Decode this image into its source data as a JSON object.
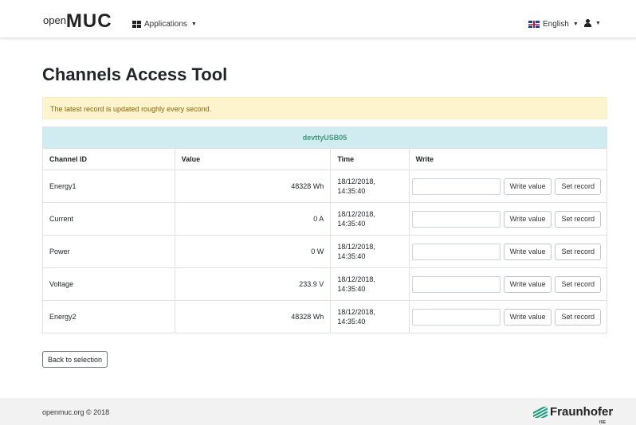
{
  "navbar": {
    "brand_open": "open",
    "brand_muc": "MUC",
    "applications_label": "Applications",
    "language_label": "English"
  },
  "page": {
    "title": "Channels Access Tool"
  },
  "alert": {
    "text": "The latest record is updated roughly every second."
  },
  "table": {
    "device": "devttyUSB05",
    "headers": {
      "channel_id": "Channel ID",
      "value": "Value",
      "time": "Time",
      "write": "Write"
    },
    "rows": [
      {
        "id": "Energy1",
        "value": "48328 Wh",
        "date": "18/12/2018,",
        "time": "14:35:40"
      },
      {
        "id": "Current",
        "value": "0 A",
        "date": "18/12/2018,",
        "time": "14:35:40"
      },
      {
        "id": "Power",
        "value": "0 W",
        "date": "18/12/2018,",
        "time": "14:35:40"
      },
      {
        "id": "Voltage",
        "value": "233.9 V",
        "date": "18/12/2018,",
        "time": "14:35:40"
      },
      {
        "id": "Energy2",
        "value": "48328 Wh",
        "date": "18/12/2018,",
        "time": "14:35:40"
      }
    ],
    "write_value_label": "Write value",
    "set_record_label": "Set record",
    "write_input_value": ""
  },
  "back_button_label": "Back to selection",
  "footer": {
    "copyright": "openmuc.org © 2018",
    "logo_text": "Fraunhofer",
    "logo_sub": "ISE"
  },
  "icons": {
    "apps": "grid-icon",
    "flag": "uk-flag-icon",
    "user": "user-icon",
    "caret": "chevron-down-icon"
  },
  "colors": {
    "alert_bg": "#fdf3cd",
    "alert_text": "#856404",
    "device_row_bg": "#d1ecf1",
    "device_text": "#3d9a77",
    "footer_bg": "#f2f2f2",
    "fraunhofer_green": "#179c7d"
  }
}
